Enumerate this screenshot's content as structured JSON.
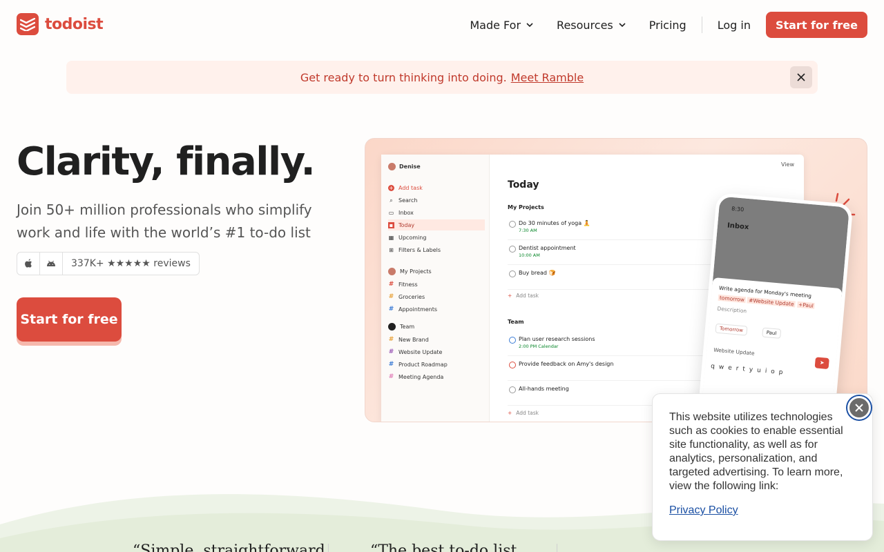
{
  "brand": {
    "name": "todoist",
    "color": "#dc4c3e"
  },
  "nav": {
    "made_for": "Made For",
    "resources": "Resources",
    "pricing": "Pricing",
    "login": "Log in",
    "start": "Start for free"
  },
  "banner": {
    "text": "Get ready to turn thinking into doing.",
    "link": "Meet Ramble"
  },
  "hero": {
    "title": "Clarity, finally.",
    "subtitle": "Join 50+ million professionals who simplify work and life with the world’s #1 to-do list app.",
    "reviews": "337K+ ★★★★★ reviews",
    "cta": "Start for free"
  },
  "preview": {
    "user": "Denise",
    "view": "View",
    "sidebar": {
      "add_task": "Add task",
      "search": "Search",
      "inbox": "Inbox",
      "today": "Today",
      "upcoming": "Upcoming",
      "filters": "Filters & Labels",
      "my_projects": "My Projects",
      "projects": [
        "Fitness",
        "Groceries",
        "Appointments"
      ],
      "team": "Team",
      "team_projects": [
        "New Brand",
        "Website Update",
        "Product Roadmap",
        "Meeting Agenda"
      ]
    },
    "main": {
      "title": "Today",
      "section1": "My Projects",
      "tasks1": [
        {
          "title": "Do 30 minutes of yoga 🧘",
          "meta": "7:30 AM"
        },
        {
          "title": "Dentist appointment",
          "meta": "10:00 AM"
        },
        {
          "title": "Buy bread 🍞",
          "meta": ""
        }
      ],
      "add_task": "Add task",
      "section2": "Team",
      "tasks2": [
        {
          "title": "Plan user research sessions",
          "meta": "2:00 PM  Calendar"
        },
        {
          "title": "Provide feedback on Amy's design",
          "meta": ""
        },
        {
          "title": "All-hands meeting",
          "meta": ""
        }
      ]
    },
    "phone": {
      "time": "8:30",
      "title": "Inbox",
      "task": "Write agenda for Monday's meeting",
      "tag_tomorrow": "tomorrow",
      "tag_project": "#Website Update",
      "tag_person": "+Paul",
      "description": "Description",
      "chip_date": "Tomorrow",
      "chip_person": "Paul",
      "project": "Website Update",
      "keys": "qwertyuiop"
    }
  },
  "quotes": {
    "q1": "“Simple, straightforward",
    "q2": "“The best to-do list"
  },
  "cookie": {
    "text": "This website utilizes technologies such as cookies to enable essential site functionality, as well as for analytics, personalization, and targeted advertising. To learn more, view the following link:",
    "link": "Privacy Policy"
  }
}
